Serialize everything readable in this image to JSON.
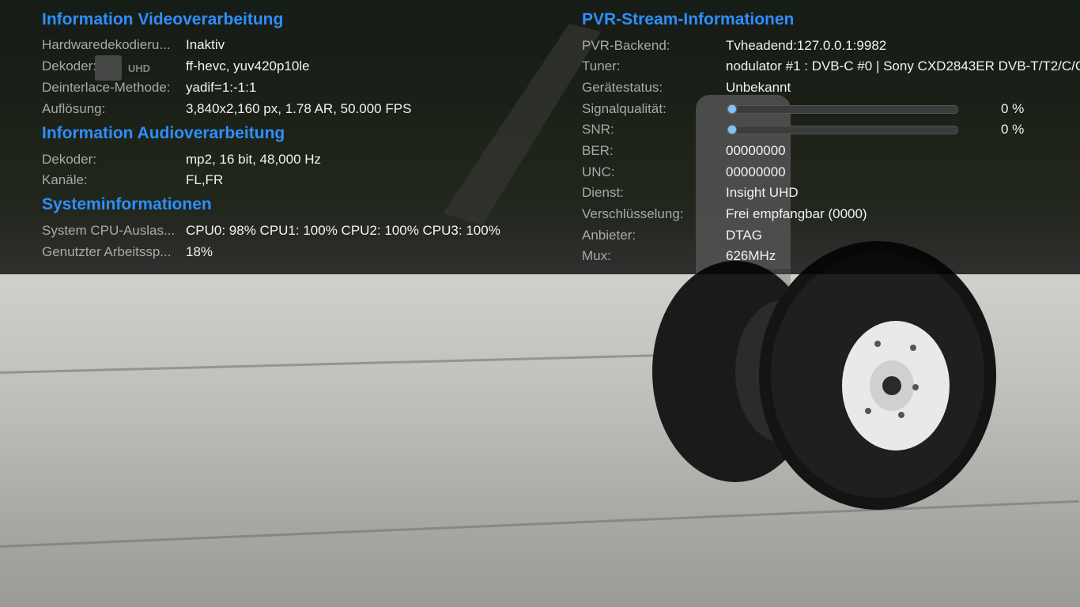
{
  "video": {
    "title": "Information Videoverarbeitung",
    "rows": [
      {
        "label": "Hardwaredekodieru...",
        "value": "Inaktiv"
      },
      {
        "label": "Dekoder:",
        "value": "ff-hevc, yuv420p10le"
      },
      {
        "label": "Deinterlace-Methode:",
        "value": "yadif=1:-1:1"
      },
      {
        "label": "Auflösung:",
        "value": "3,840x2,160 px, 1.78 AR, 50.000 FPS"
      }
    ],
    "channel_logo_text": "UHD"
  },
  "audio": {
    "title": "Information Audioverarbeitung",
    "rows": [
      {
        "label": "Dekoder:",
        "value": "mp2, 16 bit, 48,000 Hz"
      },
      {
        "label": "Kanäle:",
        "value": "FL,FR"
      }
    ]
  },
  "system": {
    "title": "Systeminformationen",
    "rows": [
      {
        "label": "System CPU-Auslas...",
        "value": "CPU0:  98% CPU1: 100% CPU2: 100% CPU3: 100%"
      },
      {
        "label": "Genutzter Arbeitssp...",
        "value": "18%"
      }
    ]
  },
  "pvr": {
    "title": "PVR-Stream-Informationen",
    "backend": {
      "label": "PVR-Backend:",
      "value": "Tvheadend:127.0.0.1:9982"
    },
    "tuner": {
      "label": "Tuner:",
      "value": "nodulator #1 : DVB-C #0 | Sony CXD2843ER DVB-T/T2/C/C"
    },
    "device_status": {
      "label": "Gerätestatus:",
      "value": "Unbekannt"
    },
    "signal_quality": {
      "label": "Signalqualität:",
      "value": 0,
      "display": "0 %"
    },
    "snr": {
      "label": "SNR:",
      "value": 0,
      "display": "0 %"
    },
    "ber": {
      "label": "BER:",
      "value": "00000000"
    },
    "unc": {
      "label": "UNC:",
      "value": "00000000"
    },
    "service": {
      "label": "Dienst:",
      "value": "Insight UHD"
    },
    "encryption": {
      "label": "Verschlüsselung:",
      "value": "Frei empfangbar (0000)"
    },
    "provider": {
      "label": "Anbieter:",
      "value": "DTAG"
    },
    "mux": {
      "label": "Mux:",
      "value": "626MHz"
    }
  },
  "colors": {
    "section_title": "#2d8fff",
    "label": "#a9a9a9",
    "value": "#f2f2f2",
    "bar_knob": "#7fc4ff"
  }
}
